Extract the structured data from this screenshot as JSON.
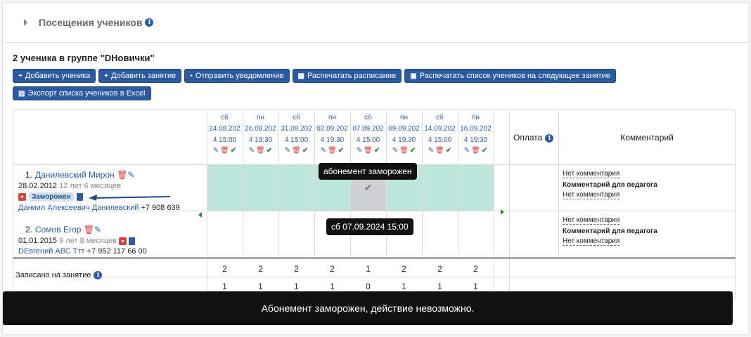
{
  "section": {
    "title": "Посещения учеников"
  },
  "group_title": "2 ученика в группе \"DНовички\"",
  "buttons": {
    "add_student": "Добавить ученика",
    "add_lesson": "Добавить занятие",
    "send_notification": "Отправить уведомление",
    "print_schedule": "Распечатать расписание",
    "print_students_next": "Распечатать список учеников на следующее занятие",
    "export_excel": "Экспорт списка учеников в Excel"
  },
  "dates": [
    {
      "dow": "сб",
      "date": "24.08.202",
      "time": "4 15:00"
    },
    {
      "dow": "пн",
      "date": "26.08.202",
      "time": "4 19:30"
    },
    {
      "dow": "сб",
      "date": "31.08.202",
      "time": "4 15:00"
    },
    {
      "dow": "пн",
      "date": "02.09.202",
      "time": "4 19:30"
    },
    {
      "dow": "сб",
      "date": "07.09.202",
      "time": "4 15:00"
    },
    {
      "dow": "пн",
      "date": "09.09.202",
      "time": "4 19:30"
    },
    {
      "dow": "сб",
      "date": "14.09.202",
      "time": "4 15:00"
    },
    {
      "dow": "пн",
      "date": "16.09.202",
      "time": "4 19:30"
    }
  ],
  "columns": {
    "payment": "Оплата",
    "comment": "Комментарий"
  },
  "students": [
    {
      "num": "1.",
      "name": "Данилевский Мирон",
      "birth": "28.02.2012",
      "age": "12 лет 6 месяцев",
      "status_badge": "Заморожен",
      "parent": "Даниил Алексеевич Данилевский",
      "phone": "+7 908 639"
    },
    {
      "num": "2.",
      "name": "Сомов Егор",
      "birth": "01.01.2015",
      "age": "9 лет 8 месяцев",
      "parent": "DЕвгений АВС Ттт",
      "phone": "+7 952 117 66 00"
    }
  ],
  "comments": {
    "no_comment": "Нет комментария",
    "teacher_comment_label": "Комментарий для педагога"
  },
  "footer_rows": {
    "enrolled_label": "Записано на занятие",
    "enrolled_counts": [
      "2",
      "2",
      "2",
      "2",
      "1",
      "2",
      "2",
      "2"
    ],
    "attended_counts": [
      "1",
      "1",
      "1",
      "1",
      "0",
      "1",
      "1",
      "1"
    ]
  },
  "tooltips": {
    "frozen": "абонемент заморожен",
    "date_time": "сб 07.09.2024 15:00"
  },
  "toast": "Абонемент заморожен, действие невозможно.",
  "colors": {
    "frozen_row": "#bfe6dc",
    "selected_cell": "#cfd0d4",
    "button": "#2c5aa0",
    "link": "#2a5fa8"
  }
}
